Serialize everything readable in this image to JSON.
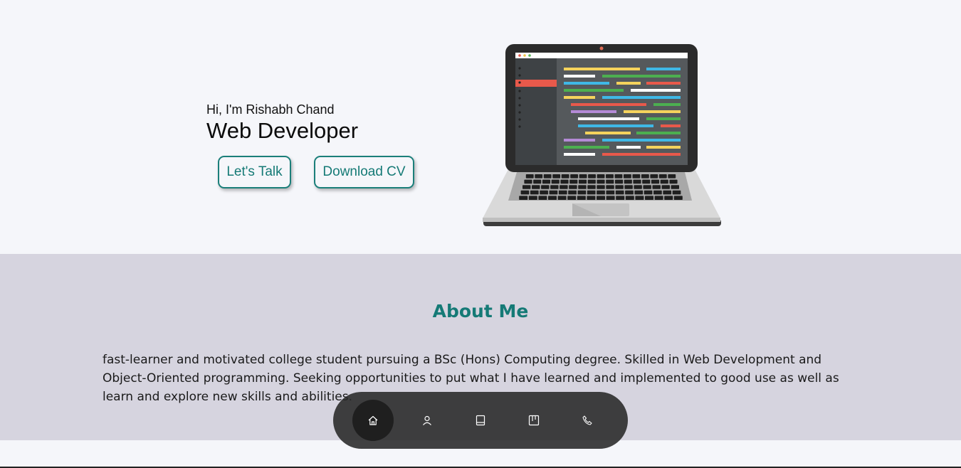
{
  "hero": {
    "greeting": "Hi, I'm Rishabh Chand",
    "role": "Web Developer",
    "buttons": {
      "talk": "Let's Talk",
      "cv": "Download CV"
    },
    "image": "laptop-with-code-illustration"
  },
  "about": {
    "title": "About Me",
    "text": "fast-learner and motivated college student pursuing a BSc (Hons) Computing degree. Skilled in Web Development and Object-Oriented programming. Seeking opportunities to put what I have learned and implemented to good use as well as learn and explore new skills and abilities."
  },
  "nav": {
    "items": [
      {
        "icon": "home-icon",
        "active": true
      },
      {
        "icon": "user-icon",
        "active": false
      },
      {
        "icon": "book-icon",
        "active": false
      },
      {
        "icon": "portfolio-icon",
        "active": false
      },
      {
        "icon": "phone-icon",
        "active": false
      }
    ]
  },
  "colors": {
    "accent": "#157a76",
    "page_bg": "#f5f6fa",
    "about_bg": "#d6d4df",
    "nav_bg": "#3a3a3a"
  }
}
